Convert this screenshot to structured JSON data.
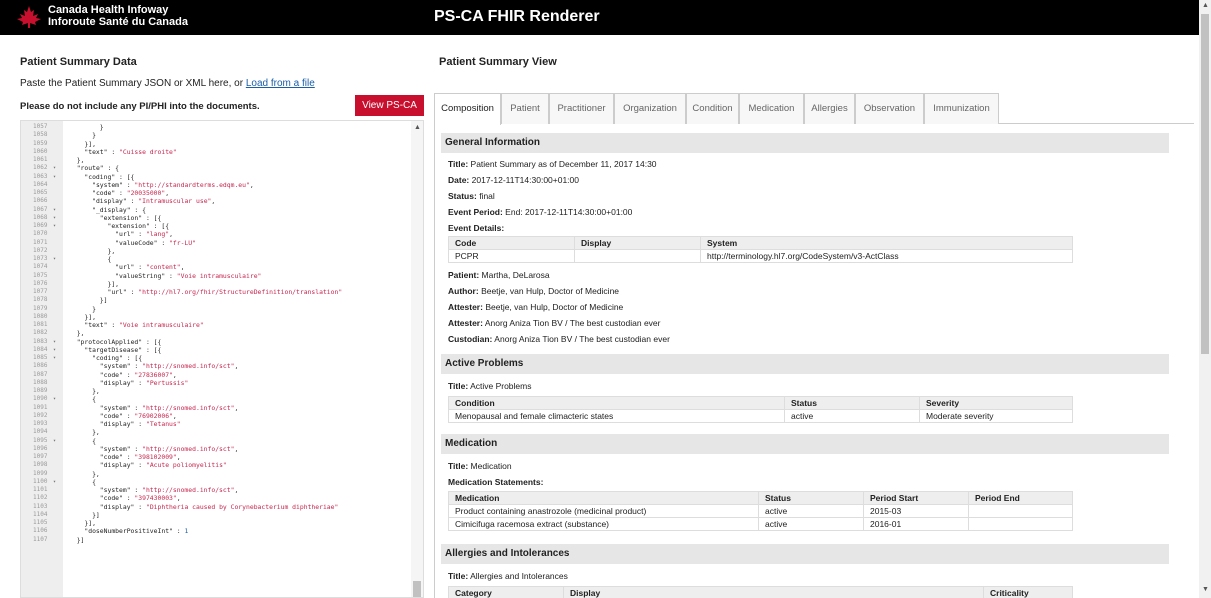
{
  "header": {
    "org_name_en": "Canada Health Infoway",
    "org_name_fr": "Inforoute Santé du Canada",
    "app_title": "PS-CA FHIR Renderer",
    "brand_color": "#c8102e"
  },
  "left": {
    "title": "Patient Summary Data",
    "paste_text": "Paste the Patient Summary JSON or XML here, or",
    "load_link": "Load from a file",
    "warning": "Please do not include any PI/PHI into the documents.",
    "view_button": "View PS-CA",
    "editor": {
      "lines": [
        {
          "n": "1057",
          "fold": "",
          "code": "        }"
        },
        {
          "n": "1058",
          "fold": "",
          "code": "      }"
        },
        {
          "n": "1059",
          "fold": "",
          "code": "    }],"
        },
        {
          "n": "1060",
          "fold": "",
          "code": "    \"text\" : \"Cuisse droite\""
        },
        {
          "n": "1061",
          "fold": "",
          "code": "  },"
        },
        {
          "n": "1062",
          "fold": "▾",
          "code": "  \"route\" : {"
        },
        {
          "n": "1063",
          "fold": "▾",
          "code": "    \"coding\" : [{"
        },
        {
          "n": "1064",
          "fold": "",
          "code": "      \"system\" : \"http://standardterms.edqm.eu\","
        },
        {
          "n": "1065",
          "fold": "",
          "code": "      \"code\" : \"20035000\","
        },
        {
          "n": "1066",
          "fold": "",
          "code": "      \"display\" : \"Intramuscular use\","
        },
        {
          "n": "1067",
          "fold": "▾",
          "code": "      \"_display\" : {"
        },
        {
          "n": "1068",
          "fold": "▾",
          "code": "        \"extension\" : [{"
        },
        {
          "n": "1069",
          "fold": "▾",
          "code": "          \"extension\" : [{"
        },
        {
          "n": "1070",
          "fold": "",
          "code": "            \"url\" : \"lang\","
        },
        {
          "n": "1071",
          "fold": "",
          "code": "            \"valueCode\" : \"fr-LU\""
        },
        {
          "n": "1072",
          "fold": "",
          "code": "          },"
        },
        {
          "n": "1073",
          "fold": "▾",
          "code": "          {"
        },
        {
          "n": "1074",
          "fold": "",
          "code": "            \"url\" : \"content\","
        },
        {
          "n": "1075",
          "fold": "",
          "code": "            \"valueString\" : \"Voie intramusculaire\""
        },
        {
          "n": "1076",
          "fold": "",
          "code": "          }],"
        },
        {
          "n": "1077",
          "fold": "",
          "code": "          \"url\" : \"http://hl7.org/fhir/StructureDefinition/translation\""
        },
        {
          "n": "1078",
          "fold": "",
          "code": "        }]"
        },
        {
          "n": "1079",
          "fold": "",
          "code": "      }"
        },
        {
          "n": "1080",
          "fold": "",
          "code": "    }],"
        },
        {
          "n": "1081",
          "fold": "",
          "code": "    \"text\" : \"Voie intramusculaire\""
        },
        {
          "n": "1082",
          "fold": "",
          "code": "  },"
        },
        {
          "n": "1083",
          "fold": "▾",
          "code": "  \"protocolApplied\" : [{"
        },
        {
          "n": "1084",
          "fold": "▾",
          "code": "    \"targetDisease\" : [{"
        },
        {
          "n": "1085",
          "fold": "▾",
          "code": "      \"coding\" : [{"
        },
        {
          "n": "1086",
          "fold": "",
          "code": "        \"system\" : \"http://snomed.info/sct\","
        },
        {
          "n": "1087",
          "fold": "",
          "code": "        \"code\" : \"27836007\","
        },
        {
          "n": "1088",
          "fold": "",
          "code": "        \"display\" : \"Pertussis\""
        },
        {
          "n": "1089",
          "fold": "",
          "code": "      },"
        },
        {
          "n": "1090",
          "fold": "▾",
          "code": "      {"
        },
        {
          "n": "1091",
          "fold": "",
          "code": "        \"system\" : \"http://snomed.info/sct\","
        },
        {
          "n": "1092",
          "fold": "",
          "code": "        \"code\" : \"76902006\","
        },
        {
          "n": "1093",
          "fold": "",
          "code": "        \"display\" : \"Tetanus\""
        },
        {
          "n": "1094",
          "fold": "",
          "code": "      },"
        },
        {
          "n": "1095",
          "fold": "▾",
          "code": "      {"
        },
        {
          "n": "1096",
          "fold": "",
          "code": "        \"system\" : \"http://snomed.info/sct\","
        },
        {
          "n": "1097",
          "fold": "",
          "code": "        \"code\" : \"398102009\","
        },
        {
          "n": "1098",
          "fold": "",
          "code": "        \"display\" : \"Acute poliomyelitis\""
        },
        {
          "n": "1099",
          "fold": "",
          "code": "      },"
        },
        {
          "n": "1100",
          "fold": "▾",
          "code": "      {"
        },
        {
          "n": "1101",
          "fold": "",
          "code": "        \"system\" : \"http://snomed.info/sct\","
        },
        {
          "n": "1102",
          "fold": "",
          "code": "        \"code\" : \"397430003\","
        },
        {
          "n": "1103",
          "fold": "",
          "code": "        \"display\" : \"Diphtheria caused by Corynebacterium diphtheriae\""
        },
        {
          "n": "1104",
          "fold": "",
          "code": "      }]"
        },
        {
          "n": "1105",
          "fold": "",
          "code": "    }],"
        },
        {
          "n": "1106",
          "fold": "",
          "code": "    \"doseNumberPositiveInt\" : 1"
        },
        {
          "n": "1107",
          "fold": "",
          "code": "  }]"
        }
      ]
    }
  },
  "right": {
    "title": "Patient Summary View",
    "tabs": [
      "Composition",
      "Patient",
      "Practitioner",
      "Organization",
      "Condition",
      "Medication",
      "Allergies",
      "Observation",
      "Immunization"
    ],
    "active_tab": "Composition",
    "general": {
      "heading": "General Information",
      "title_label": "Title:",
      "title_value": "Patient Summary as of December 11, 2017 14:30",
      "date_label": "Date:",
      "date_value": "2017-12-11T14:30:00+01:00",
      "status_label": "Status:",
      "status_value": "final",
      "event_label": "Event Period:",
      "event_value": "End: 2017-12-11T14:30:00+01:00",
      "event_details_label": "Event Details:",
      "event_table": {
        "headers": [
          "Code",
          "Display",
          "System"
        ],
        "rows": [
          [
            "PCPR",
            "",
            "http://terminology.hl7.org/CodeSystem/v3-ActClass"
          ]
        ]
      },
      "patient_label": "Patient:",
      "patient_value": "Martha, DeLarosa",
      "author_label": "Author:",
      "author_value": "Beetje, van Hulp, Doctor of Medicine",
      "attester1_label": "Attester:",
      "attester1_value": "Beetje, van Hulp, Doctor of Medicine",
      "attester2_label": "Attester:",
      "attester2_value": "Anorg Aniza Tion BV / The best custodian ever",
      "custodian_label": "Custodian:",
      "custodian_value": "Anorg Aniza Tion BV / The best custodian ever"
    },
    "problems": {
      "heading": "Active Problems",
      "title_label": "Title:",
      "title_value": "Active Problems",
      "table": {
        "headers": [
          "Condition",
          "Status",
          "Severity"
        ],
        "rows": [
          [
            "Menopausal and female climacteric states",
            "active",
            "Moderate severity"
          ]
        ]
      }
    },
    "medication": {
      "heading": "Medication",
      "title_label": "Title:",
      "title_value": "Medication",
      "statements_label": "Medication Statements:",
      "table": {
        "headers": [
          "Medication",
          "Status",
          "Period Start",
          "Period End"
        ],
        "rows": [
          [
            "Product containing anastrozole (medicinal product)",
            "active",
            "2015-03",
            ""
          ],
          [
            "Cimicifuga racemosa extract (substance)",
            "active",
            "2016-01",
            ""
          ]
        ]
      }
    },
    "allergies": {
      "heading": "Allergies and Intolerances",
      "title_label": "Title:",
      "title_value": "Allergies and Intolerances",
      "table": {
        "headers": [
          "Category",
          "Display",
          "Criticality"
        ]
      }
    }
  }
}
